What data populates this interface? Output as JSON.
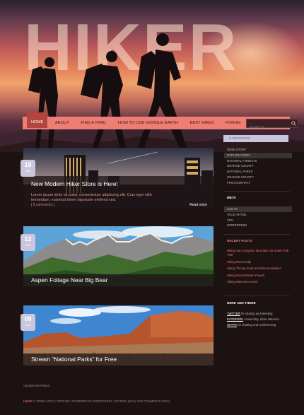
{
  "brand": {
    "title": "HIKER"
  },
  "nav": {
    "items": [
      {
        "label": "HOME",
        "active": true
      },
      {
        "label": "ABOUT"
      },
      {
        "label": "FIND A TRAIL"
      },
      {
        "label": "HOW TO USE GOOGLE EARTH"
      },
      {
        "label": "BEST HIKES"
      },
      {
        "label": "FORUM"
      }
    ],
    "search_placeholder": "SEARCH"
  },
  "posts": [
    {
      "day": "15",
      "month": "Oct",
      "title": "New Modern Hiker Store is Here!",
      "excerpt": "Lorem ipsum dolor sit amet, consectetuer adipiscing elit. Cras eget nibh fermentum, euismod lorem dignissim eleifend sed.",
      "comments": "[ 9 comments ]",
      "more": "Read more"
    },
    {
      "day": "12",
      "month": "Oct",
      "title": "Aspen Foliage Near Big Bear"
    },
    {
      "day": "09",
      "month": "Oct",
      "title": "Stream “National Parks” for Free"
    }
  ],
  "older_entries": "OLDER ENTRIES",
  "sidebar": {
    "categories_title": "CATEGORIES",
    "categories": [
      "DESK STORY",
      "EXPLORATIONS",
      "NATIONAL FORESTS",
      "ORANGE COUNTY",
      "NATIONAL PARKS",
      "ORANGE COUNTY",
      "PHOTOGRAPHY"
    ],
    "categories_selected": 1,
    "meta_title": "META",
    "meta": [
      "LOG IN",
      "VALID XHTML",
      "XFN",
      "WORDPRESS"
    ],
    "meta_selected": 0,
    "recent_title": "RECENT POSTS",
    "recent": [
      "Hiking San Gorgonio Mountain via South Fork Trail",
      "Hiking Mount Islip",
      "Hiking Throop Peak and Mount Hawkins",
      "Hiking Mount Baden-Powell",
      "Hiking Manzana Creek"
    ],
    "here_title": "HERE AND THERE",
    "links": [
      {
        "name": "TWITTER",
        "desc": "for sharing and tweeting"
      },
      {
        "name": "FACEBOOK",
        "desc": "connecting, show interests"
      },
      {
        "name": "SKYPE",
        "desc": "for chatting and conferencing"
      }
    ]
  },
  "footer": {
    "prefix": "HIKER",
    "text": "© TEMPLATES © PROUDLY POWERED BY WORDPRESS. ENTRIES (RSS) AND COMMENTS (RSS)"
  }
}
